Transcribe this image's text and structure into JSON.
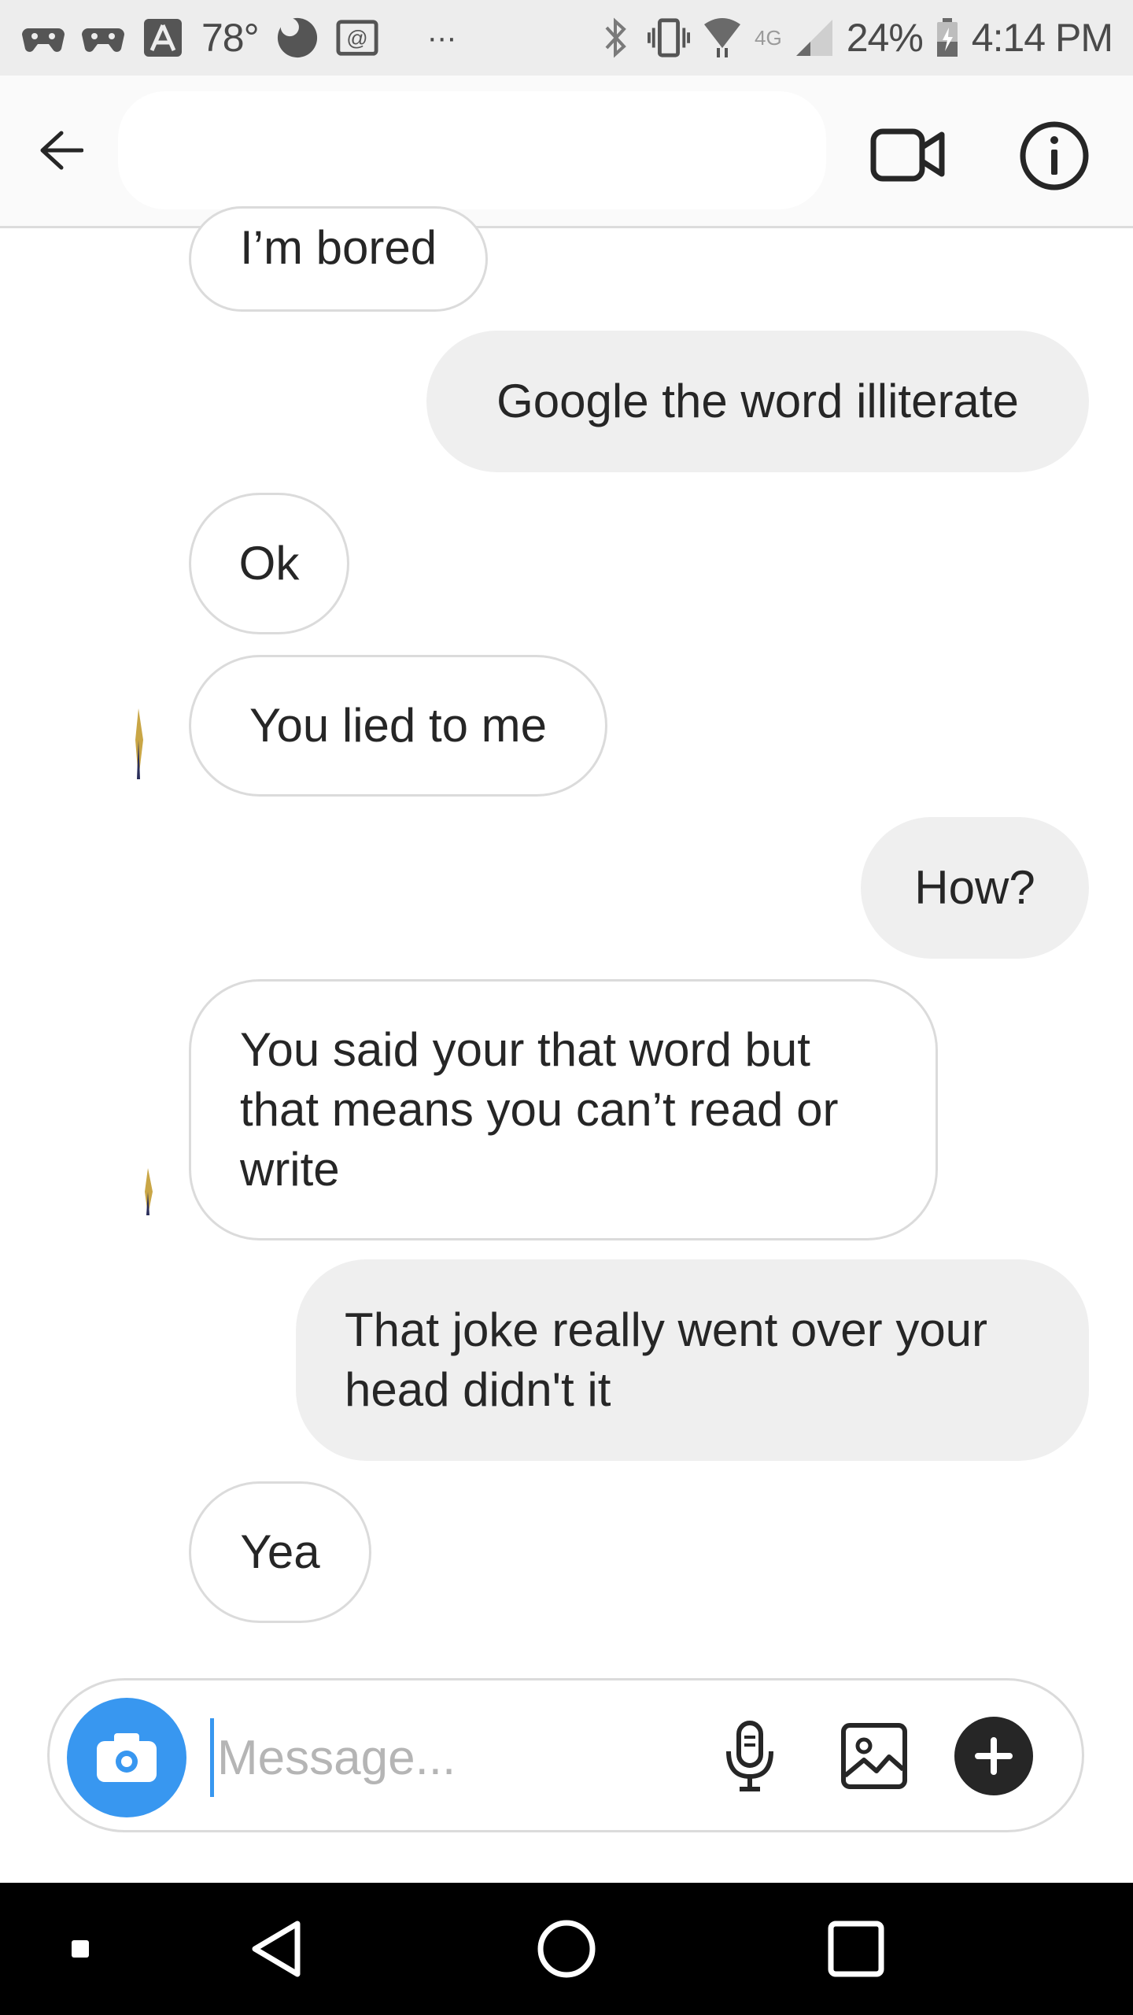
{
  "status_bar": {
    "temperature": "78°",
    "network": "4G",
    "battery": "24%",
    "time": "4:14 PM",
    "more": "···"
  },
  "header": {
    "back_icon": "arrow-left-icon",
    "video_icon": "video-call-icon",
    "info_icon": "info-icon"
  },
  "messages": [
    {
      "sender": "them",
      "text": "I’m bored"
    },
    {
      "sender": "me",
      "text": "Google the word illiterate"
    },
    {
      "sender": "them",
      "text": "Ok"
    },
    {
      "sender": "them",
      "text": "You lied to me"
    },
    {
      "sender": "me",
      "text": "How?"
    },
    {
      "sender": "them",
      "text": "You said your that word but that means you can’t read or write"
    },
    {
      "sender": "me",
      "text": "That joke really went over your head didn't it"
    },
    {
      "sender": "them",
      "text": "Yea"
    }
  ],
  "composer": {
    "placeholder": "Message...",
    "camera_icon": "camera-icon",
    "mic_icon": "microphone-icon",
    "gallery_icon": "image-icon",
    "add_icon": "plus-icon"
  },
  "colors": {
    "accent": "#3897f0",
    "outgoing_bubble": "#efefef",
    "incoming_border": "#dbdbdb"
  }
}
